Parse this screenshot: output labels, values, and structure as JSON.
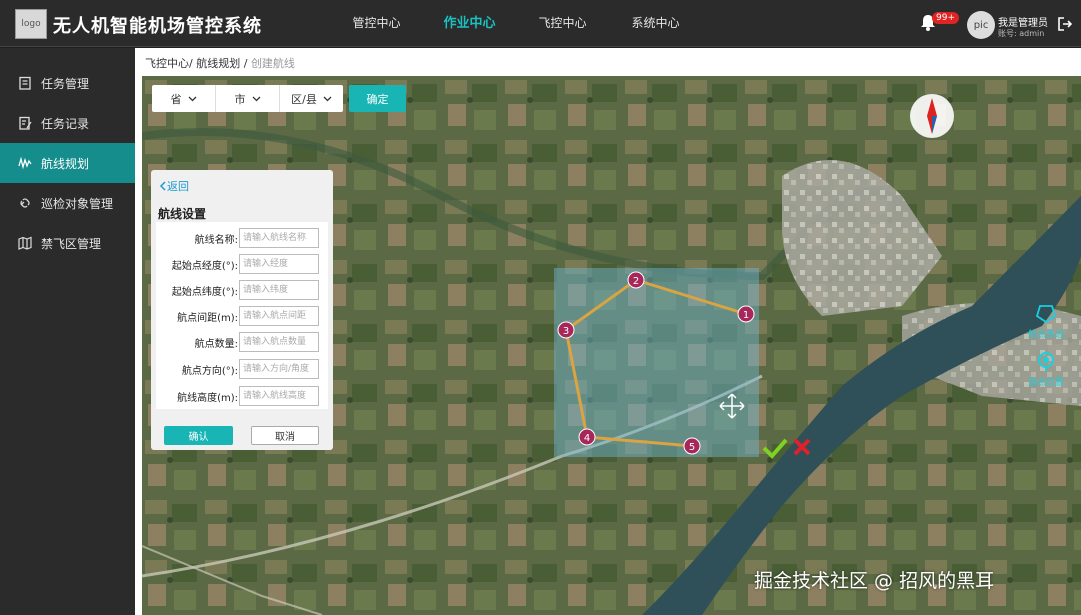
{
  "header": {
    "logo": "logo",
    "title": "无人机智能机场管控系统",
    "nav": [
      {
        "label": "管控中心",
        "active": false
      },
      {
        "label": "作业中心",
        "active": true
      },
      {
        "label": "飞控中心",
        "active": false
      },
      {
        "label": "系统中心",
        "active": false
      }
    ],
    "notification_badge": "99+",
    "avatar": "pic",
    "user_name": "我是管理员",
    "user_account": "账号: admin"
  },
  "sidebar": {
    "items": [
      {
        "label": "任务管理",
        "icon": "clipboard-icon",
        "active": false
      },
      {
        "label": "任务记录",
        "icon": "edit-document-icon",
        "active": false
      },
      {
        "label": "航线规划",
        "icon": "route-icon",
        "active": true
      },
      {
        "label": "巡检对象管理",
        "icon": "link-icon",
        "active": false
      },
      {
        "label": "禁飞区管理",
        "icon": "map-icon",
        "active": false
      }
    ]
  },
  "breadcrumb": {
    "part1": "飞控中心",
    "sep1": "/",
    "part2": "航线规划",
    "sep2": "/",
    "current": "创建航线"
  },
  "region": {
    "province": "省",
    "city": "市",
    "district": "区/县",
    "confirm": "确定"
  },
  "panel": {
    "back": "返回",
    "title": "航线设置",
    "fields": [
      {
        "label": "航线名称:",
        "placeholder": "请输入航线名称",
        "value": ""
      },
      {
        "label": "起始点经度(°):",
        "placeholder": "请输入经度",
        "value": ""
      },
      {
        "label": "起始点纬度(°):",
        "placeholder": "请输入纬度",
        "value": ""
      },
      {
        "label": "航点间距(m):",
        "placeholder": "请输入航点间距",
        "value": ""
      },
      {
        "label": "航点数量:",
        "placeholder": "请输入航点数量",
        "value": ""
      },
      {
        "label": "航点方向(°):",
        "placeholder": "请输入方向/角度",
        "value": ""
      },
      {
        "label": "航线高度(m):",
        "placeholder": "请输入航线高度",
        "value": ""
      }
    ],
    "ok": "确认",
    "cancel": "取消"
  },
  "waypoints": [
    "1",
    "2",
    "3",
    "4",
    "5"
  ],
  "map_tools": {
    "tool1": "航点多边",
    "tool2": "选点位置"
  },
  "colors": {
    "accent": "#19b5b5",
    "sidebar_active": "#158d8d",
    "waypoint": "#a8275a",
    "route_line": "#d9a441"
  },
  "watermark": "掘金技术社区 @ 招风的黑耳"
}
